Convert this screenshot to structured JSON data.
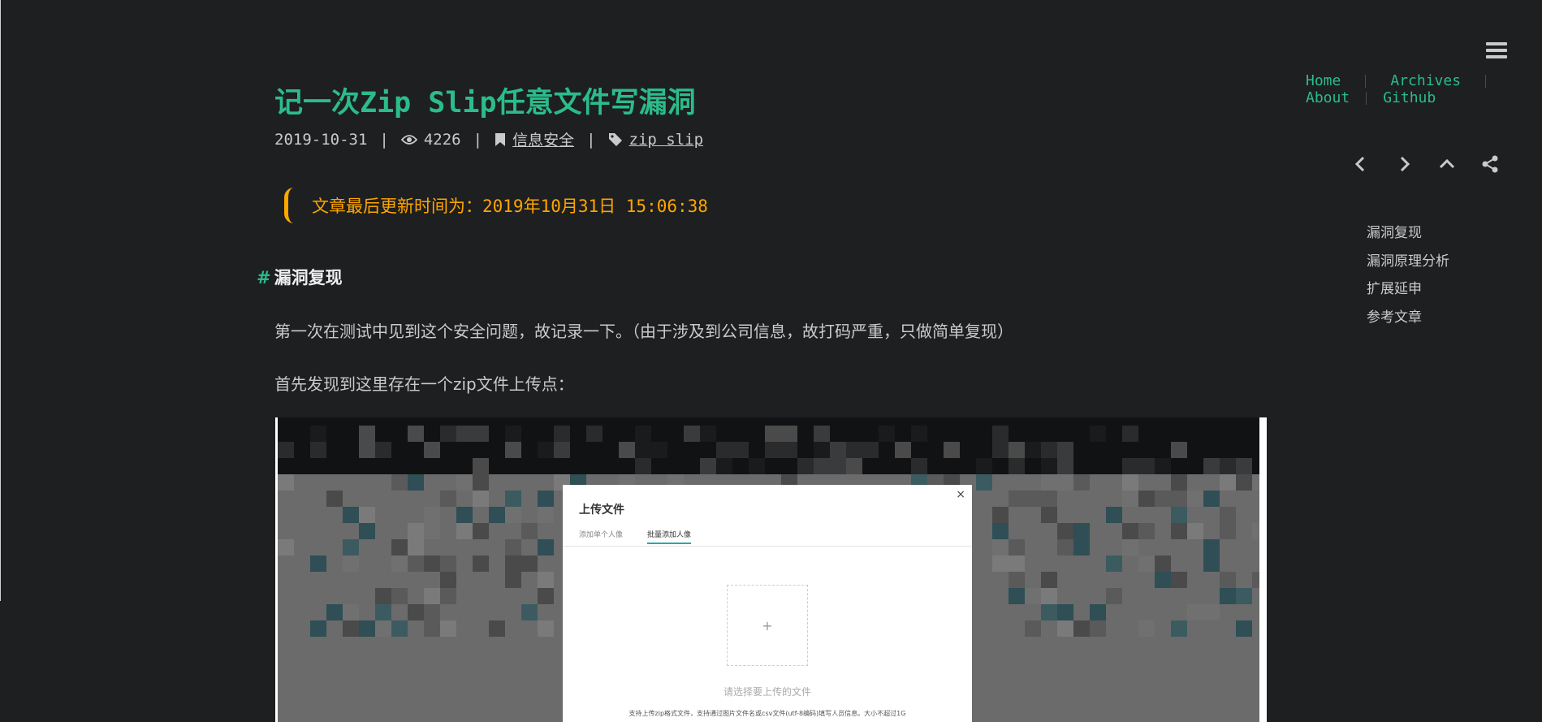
{
  "nav": {
    "menu_icon": "hamburger-icon",
    "links": [
      "Home",
      "Archives",
      "About",
      "Github"
    ]
  },
  "page_actions": [
    "chevron-left-icon",
    "chevron-right-icon",
    "chevron-up-icon",
    "share-icon"
  ],
  "toc": [
    "漏洞复现",
    "漏洞原理分析",
    "扩展延申",
    "参考文章"
  ],
  "post": {
    "title": "记一次Zip Slip任意文件写漏洞",
    "date": "2019-10-31",
    "views": "4226",
    "separator": "|",
    "category": "信息安全",
    "tag": "zip slip",
    "updated_notice": "文章最后更新时间为：2019年10月31日 15:06:38"
  },
  "section": {
    "hash": "#",
    "heading": "漏洞复现",
    "para1": "第一次在测试中见到这个安全问题，故记录一下。（由于涉及到公司信息，故打码严重，只做简单复现）",
    "para2": "首先发现到这里存在一个zip文件上传点："
  },
  "screenshot": {
    "dialog_close": "×",
    "dialog_title": "上传文件",
    "tab_single": "添加单个人像",
    "tab_batch": "批量添加人像",
    "drop_plus": "+",
    "drop_hint": "请选择要上传的文件",
    "note": "支持上传zip格式文件，支持通过图片文件名或csv文件(utf-8编码)填写人员信息。大小不超过1G"
  },
  "colors": {
    "background": "#1d1f21",
    "accent": "#2bbc8a",
    "notice": "#ffa500",
    "text": "#c9cacc"
  }
}
